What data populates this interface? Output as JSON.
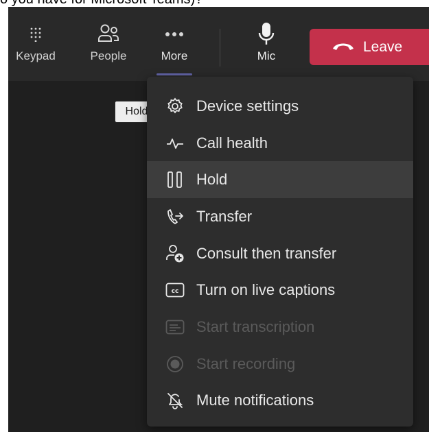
{
  "page_top_text": "o you have for Microsoft Teams)?",
  "toolbar": {
    "keypad_label": "Keypad",
    "people_label": "People",
    "more_label": "More",
    "mic_label": "Mic",
    "leave_label": "Leave"
  },
  "tooltip": {
    "text": "Hold"
  },
  "menu": {
    "items": [
      {
        "label": "Device settings",
        "icon": "gear-icon",
        "enabled": true
      },
      {
        "label": "Call health",
        "icon": "pulse-icon",
        "enabled": true
      },
      {
        "label": "Hold",
        "icon": "pause-icon",
        "enabled": true
      },
      {
        "label": "Transfer",
        "icon": "transfer-icon",
        "enabled": true
      },
      {
        "label": "Consult then transfer",
        "icon": "person-add-icon",
        "enabled": true
      },
      {
        "label": "Turn on live captions",
        "icon": "cc-icon",
        "enabled": true
      },
      {
        "label": "Start transcription",
        "icon": "transcript-icon",
        "enabled": false
      },
      {
        "label": "Start recording",
        "icon": "record-icon",
        "enabled": false
      },
      {
        "label": "Mute notifications",
        "icon": "bell-off-icon",
        "enabled": true
      }
    ]
  },
  "colors": {
    "background": "#1f1f1f",
    "toolbar": "#292929",
    "menu": "#2d2d2d",
    "leave": "#c4314b",
    "accent": "#6264a7"
  }
}
